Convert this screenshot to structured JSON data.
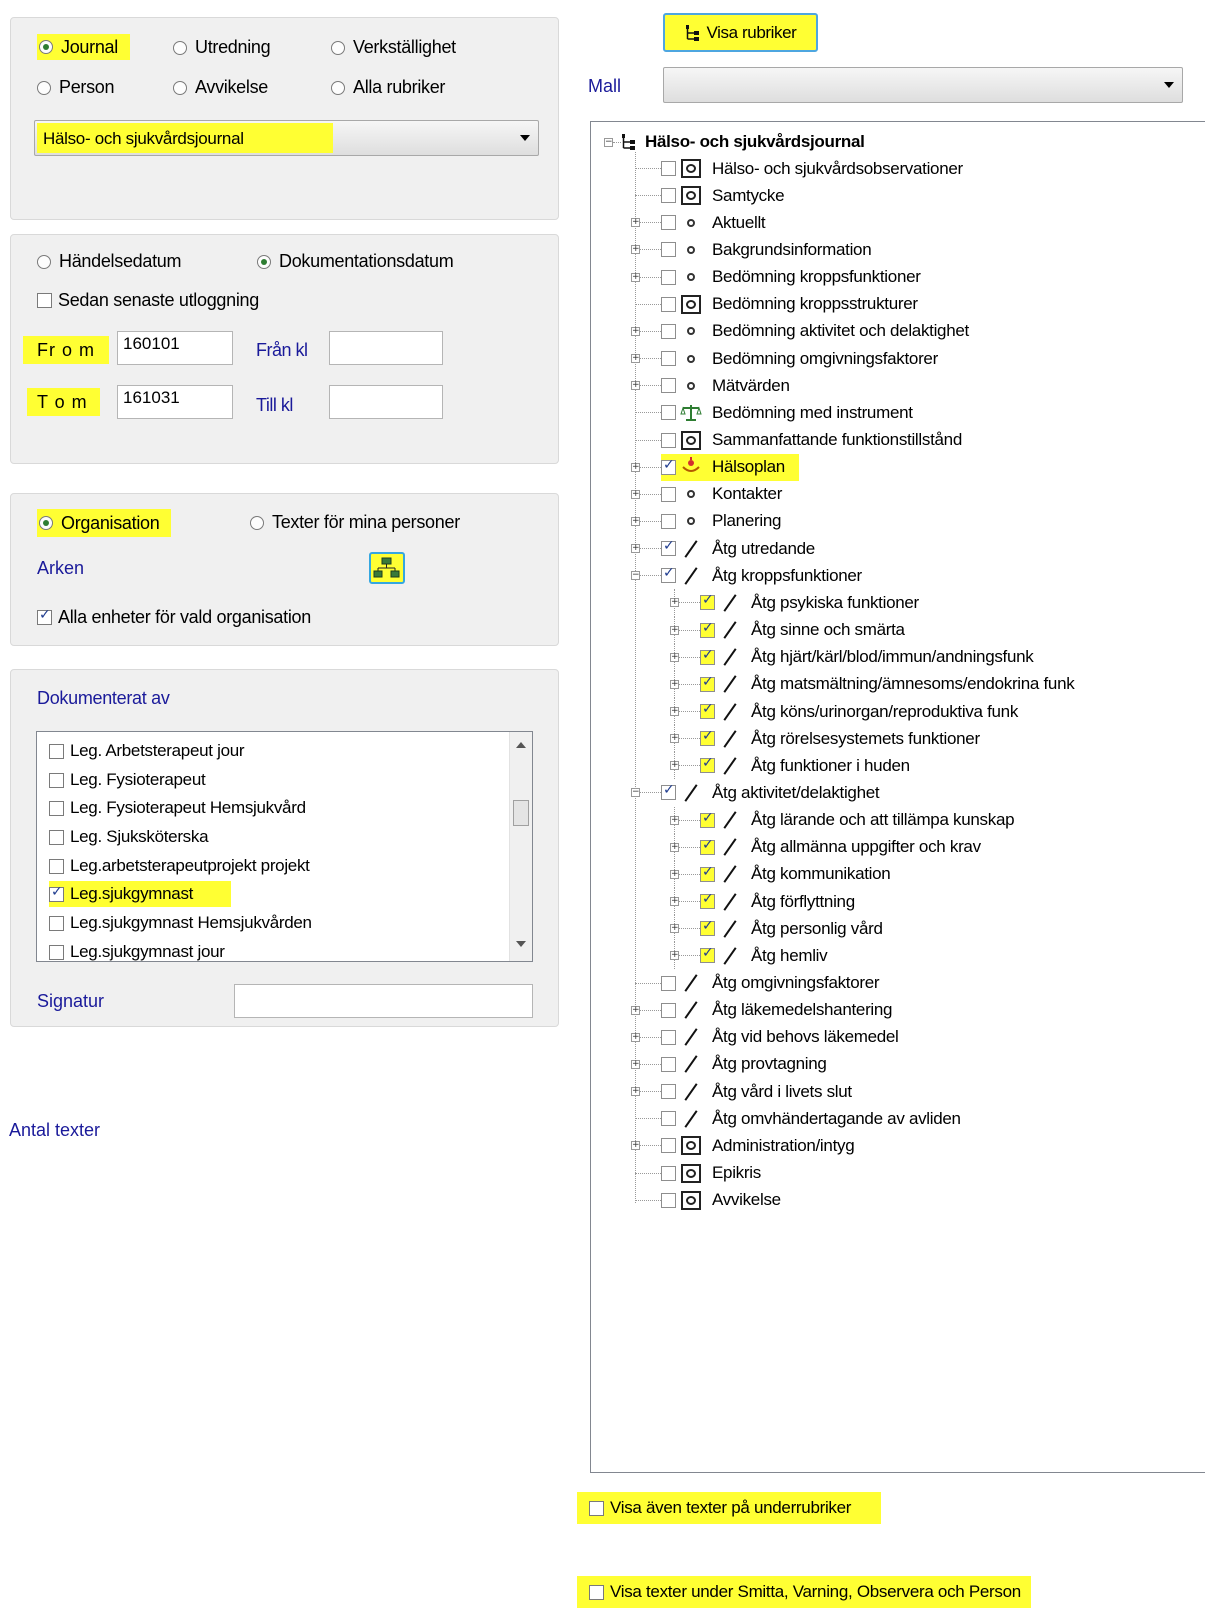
{
  "doc_types": {
    "options": [
      {
        "label": "Journal",
        "selected": true
      },
      {
        "label": "Utredning",
        "selected": false
      },
      {
        "label": "Verkställighet",
        "selected": false
      },
      {
        "label": "Person",
        "selected": false
      },
      {
        "label": "Avvikelse",
        "selected": false
      },
      {
        "label": "Alla rubriker",
        "selected": false
      }
    ],
    "journal_select": "Hälso- och sjukvårdsjournal"
  },
  "dates": {
    "event_date": "Händelsedatum",
    "doc_date": "Dokumentationsdatum",
    "since_logout": "Sedan senaste utloggning",
    "from_label": "Fr o m",
    "from_value": "160101",
    "from_time_label": "Från kl",
    "to_label": "T o m",
    "to_value": "161031",
    "to_time_label": "Till kl"
  },
  "org": {
    "organisation": "Organisation",
    "my_persons": "Texter för mina personer",
    "arken": "Arken",
    "all_units": "Alla enheter för vald organisation"
  },
  "documented_by": {
    "title": "Dokumenterat av",
    "items": [
      {
        "label": "Leg. Arbetsterapeut jour",
        "checked": false
      },
      {
        "label": "Leg. Fysioterapeut",
        "checked": false
      },
      {
        "label": "Leg. Fysioterapeut Hemsjukvård",
        "checked": false
      },
      {
        "label": "Leg. Sjuksköterska",
        "checked": false
      },
      {
        "label": "Leg.arbetsterapeutprojekt projekt",
        "checked": false
      },
      {
        "label": "Leg.sjukgymnast",
        "checked": true
      },
      {
        "label": "Leg.sjukgymnast Hemsjukvården",
        "checked": false
      },
      {
        "label": "Leg.sjukgymnast jour",
        "checked": false
      }
    ],
    "signatur": "Signatur"
  },
  "antal_texter": "Antal texter",
  "right": {
    "show_headings": "Visa rubriker",
    "mall_label": "Mall",
    "tree_root": "Hälso- och sjukvårdsjournal",
    "tree": [
      {
        "label": "Hälso- och sjukvårdsobservationer",
        "level": 1,
        "icon": "clipboard-icon",
        "checked": false,
        "toggle": ""
      },
      {
        "label": "Samtycke",
        "level": 1,
        "icon": "clipboard-icon",
        "checked": false,
        "toggle": ""
      },
      {
        "label": "Aktuellt",
        "level": 1,
        "icon": "dot-icon",
        "checked": false,
        "toggle": "+"
      },
      {
        "label": "Bakgrundsinformation",
        "level": 1,
        "icon": "dot-icon",
        "checked": false,
        "toggle": "+"
      },
      {
        "label": "Bedömning kroppsfunktioner",
        "level": 1,
        "icon": "dot-icon",
        "checked": false,
        "toggle": "+"
      },
      {
        "label": "Bedömning kroppsstrukturer",
        "level": 1,
        "icon": "clipboard-icon",
        "checked": false,
        "toggle": ""
      },
      {
        "label": "Bedömning aktivitet och delaktighet",
        "level": 1,
        "icon": "dot-icon",
        "checked": false,
        "toggle": "+"
      },
      {
        "label": "Bedömning omgivningsfaktorer",
        "level": 1,
        "icon": "dot-icon",
        "checked": false,
        "toggle": "+"
      },
      {
        "label": "Mätvärden",
        "level": 1,
        "icon": "dot-icon",
        "checked": false,
        "toggle": "+"
      },
      {
        "label": "Bedömning med instrument",
        "level": 1,
        "icon": "scale-icon",
        "checked": false,
        "toggle": ""
      },
      {
        "label": "Sammanfattande funktionstillstånd",
        "level": 1,
        "icon": "clipboard-icon",
        "checked": false,
        "toggle": ""
      },
      {
        "label": "Hälsoplan",
        "level": 1,
        "icon": "plan-icon",
        "checked": true,
        "toggle": "+",
        "highlight": true
      },
      {
        "label": "Kontakter",
        "level": 1,
        "icon": "dot-icon",
        "checked": false,
        "toggle": "+"
      },
      {
        "label": "Planering",
        "level": 1,
        "icon": "dot-icon",
        "checked": false,
        "toggle": "+"
      },
      {
        "label": "Åtg utredande",
        "level": 1,
        "icon": "pen-icon",
        "checked": true,
        "toggle": "+"
      },
      {
        "label": "Åtg kroppsfunktioner",
        "level": 1,
        "icon": "pen-icon",
        "checked": true,
        "toggle": "-"
      },
      {
        "label": "Åtg psykiska funktioner",
        "level": 2,
        "icon": "pen-icon",
        "checked": true,
        "toggle": "+",
        "hlbox": true
      },
      {
        "label": "Åtg sinne och smärta",
        "level": 2,
        "icon": "pen-icon",
        "checked": true,
        "toggle": "+",
        "hlbox": true
      },
      {
        "label": "Åtg hjärt/kärl/blod/immun/andningsfunk",
        "level": 2,
        "icon": "pen-icon",
        "checked": true,
        "toggle": "+",
        "hlbox": true
      },
      {
        "label": "Åtg matsmältning/ämnesoms/endokrina funk",
        "level": 2,
        "icon": "pen-icon",
        "checked": true,
        "toggle": "+",
        "hlbox": true
      },
      {
        "label": "Åtg köns/urinorgan/reproduktiva funk",
        "level": 2,
        "icon": "pen-icon",
        "checked": true,
        "toggle": "+",
        "hlbox": true
      },
      {
        "label": "Åtg rörelsesystemets funktioner",
        "level": 2,
        "icon": "pen-icon",
        "checked": true,
        "toggle": "+",
        "hlbox": true
      },
      {
        "label": "Åtg funktioner i huden",
        "level": 2,
        "icon": "pen-icon",
        "checked": true,
        "toggle": "+",
        "hlbox": true
      },
      {
        "label": "Åtg aktivitet/delaktighet",
        "level": 1,
        "icon": "pen-icon",
        "checked": true,
        "toggle": "-"
      },
      {
        "label": "Åtg lärande och att tillämpa kunskap",
        "level": 2,
        "icon": "pen-icon",
        "checked": true,
        "toggle": "+",
        "hlbox": true
      },
      {
        "label": "Åtg allmänna uppgifter och krav",
        "level": 2,
        "icon": "pen-icon",
        "checked": true,
        "toggle": "+",
        "hlbox": true
      },
      {
        "label": "Åtg kommunikation",
        "level": 2,
        "icon": "pen-icon",
        "checked": true,
        "toggle": "+",
        "hlbox": true
      },
      {
        "label": "Åtg förflyttning",
        "level": 2,
        "icon": "pen-icon",
        "checked": true,
        "toggle": "+",
        "hlbox": true
      },
      {
        "label": "Åtg personlig vård",
        "level": 2,
        "icon": "pen-icon",
        "checked": true,
        "toggle": "+",
        "hlbox": true
      },
      {
        "label": "Åtg hemliv",
        "level": 2,
        "icon": "pen-icon",
        "checked": true,
        "toggle": "+",
        "hlbox": true
      },
      {
        "label": "Åtg omgivningsfaktorer",
        "level": 1,
        "icon": "pen-icon",
        "checked": false,
        "toggle": ""
      },
      {
        "label": "Åtg läkemedelshantering",
        "level": 1,
        "icon": "pen-icon",
        "checked": false,
        "toggle": "+"
      },
      {
        "label": "Åtg vid behovs läkemedel",
        "level": 1,
        "icon": "pen-icon",
        "checked": false,
        "toggle": "+"
      },
      {
        "label": "Åtg provtagning",
        "level": 1,
        "icon": "pen-icon",
        "checked": false,
        "toggle": "+"
      },
      {
        "label": "Åtg vård i livets slut",
        "level": 1,
        "icon": "pen-icon",
        "checked": false,
        "toggle": "+"
      },
      {
        "label": "Åtg omvhändertagande av avliden",
        "level": 1,
        "icon": "pen-icon",
        "checked": false,
        "toggle": ""
      },
      {
        "label": "Administration/intyg",
        "level": 1,
        "icon": "clipboard-icon",
        "checked": false,
        "toggle": "+"
      },
      {
        "label": "Epikris",
        "level": 1,
        "icon": "clipboard-icon",
        "checked": false,
        "toggle": ""
      },
      {
        "label": "Avvikelse",
        "level": 1,
        "icon": "clipboard-icon",
        "checked": false,
        "toggle": ""
      }
    ],
    "show_subheadings": "Visa även texter på underrubriker",
    "show_warnings": "Visa texter under Smitta, Varning, Observera och Person"
  }
}
